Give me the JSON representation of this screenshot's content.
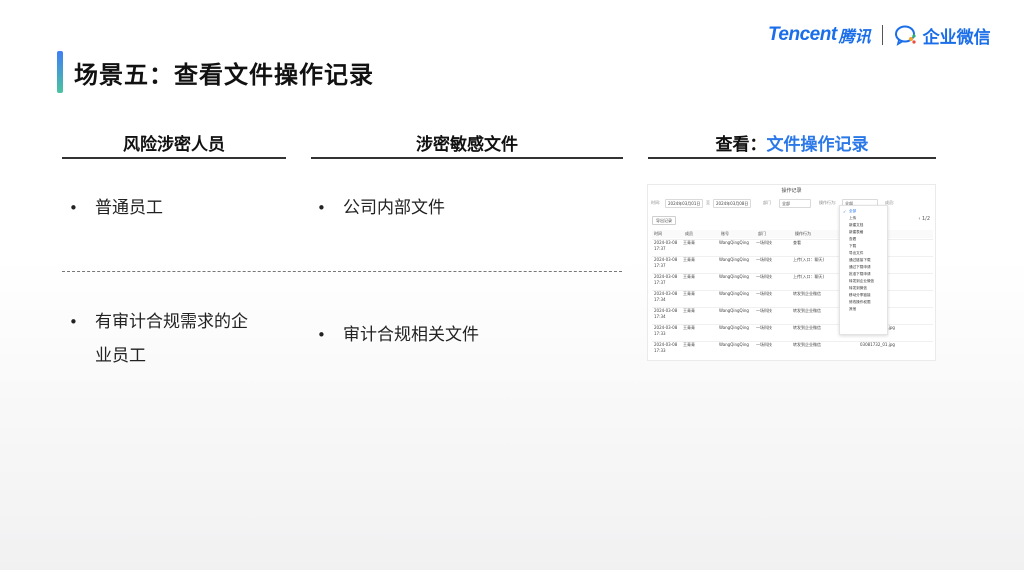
{
  "slide": {
    "title": "场景五：查看文件操作记录"
  },
  "logo": {
    "tencent": "Tencent",
    "tencent_cn": "腾讯",
    "wecom": "企业微信"
  },
  "columns": {
    "col1": {
      "heading": "风险涉密人员"
    },
    "col2": {
      "heading": "涉密敏感文件"
    },
    "col3": {
      "heading_prefix": "查看：",
      "heading_highlight": "文件操作记录"
    }
  },
  "rows": [
    {
      "col1": "普通员工",
      "col2": "公司内部文件"
    },
    {
      "col1_line1": "有审计合规需求的企",
      "col1_line2": "业员工",
      "col2": "审计合规相关文件"
    }
  ],
  "colors": {
    "accent": "#2b78e8",
    "title_bar_top": "#3f7ef5",
    "title_bar_bottom": "#4cc3a0"
  },
  "screenshot": {
    "title": "操作记录",
    "filters": {
      "time_label": "时间:",
      "date_from": "2024年03月01日",
      "to": "至",
      "date_to": "2024年03月08日",
      "dept_label": "部门",
      "dept_value": "全部",
      "action_label": "操作行为:",
      "action_value": "全部",
      "more_label": "成员:"
    },
    "export_label": "导出记录",
    "pager": "1/2",
    "headers": [
      "时间",
      "成员",
      "账号",
      "部门",
      "操作行为",
      "文件"
    ],
    "table_rows": [
      {
        "time1": "2024-03-08",
        "time2": "17:37",
        "member": "王青青",
        "account": "WangQingQing",
        "dept": "一场科技",
        "action": "查看",
        "file": ""
      },
      {
        "time1": "2024-03-08",
        "time2": "17:37",
        "member": "王青青",
        "account": "WangQingQing",
        "dept": "一场科技",
        "action": "上传(入口：聊天)",
        "file": ""
      },
      {
        "time1": "2024-03-08",
        "time2": "17:37",
        "member": "王青青",
        "account": "WangQingQing",
        "dept": "一场科技",
        "action": "上传(入口：聊天)",
        "file": ""
      },
      {
        "time1": "2024-03-08",
        "time2": "17:34",
        "member": "王青青",
        "account": "WangQingQing",
        "dept": "一场科技",
        "action": "转发到企业微信",
        "file": "jpg"
      },
      {
        "time1": "2024-03-08",
        "time2": "17:34",
        "member": "王青青",
        "account": "WangQingQing",
        "dept": "一场科技",
        "action": "转发到企业微信",
        "file": "jpg"
      },
      {
        "time1": "2024-03-08",
        "time2": "17:33",
        "member": "王青青",
        "account": "WangQingQing",
        "dept": "一场科技",
        "action": "转发到企业微信",
        "file": "03081732_01.jpg"
      },
      {
        "time1": "2024-03-08",
        "time2": "17:33",
        "member": "王青青",
        "account": "WangQingQing",
        "dept": "一场科技",
        "action": "转发到企业微信",
        "file": "03081732_01.jpg"
      }
    ],
    "dropdown_items": [
      "全部",
      "上传",
      "新建文档",
      "新建表格",
      "查看",
      "下载",
      "导出文件",
      "通过链接下载",
      "通过下载申请",
      "批准下载申请",
      "转发到企业微信",
      "转发到微信",
      "移动分享链接",
      "修改操作权限",
      "其他"
    ],
    "dropdown_sub1": "上传",
    "dropdown_sub2": "下载"
  }
}
